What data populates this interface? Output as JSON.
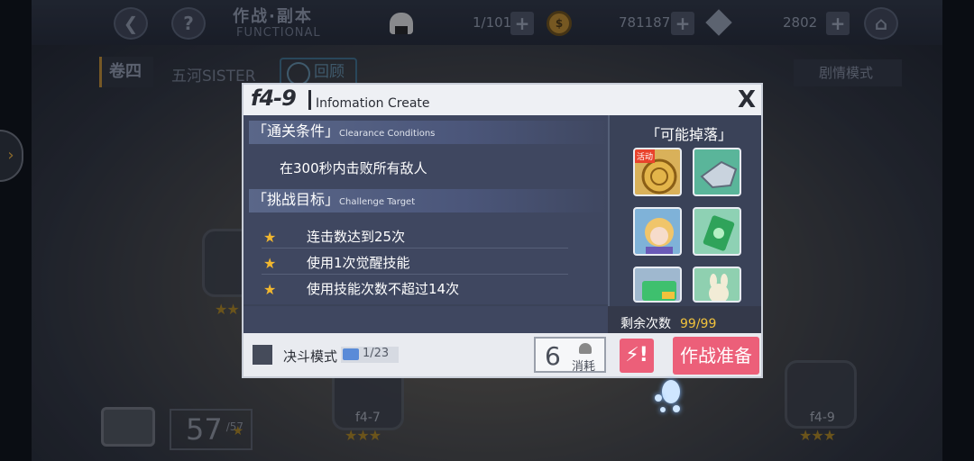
{
  "topbar": {
    "back_icon": "back-arrow-icon",
    "help": "?",
    "title": "作战·副本",
    "subtitle": "FUNCTIONAL",
    "stamina": "1/101",
    "coins": "781187",
    "gems": "2802",
    "plus": "+",
    "coin_glyph": "$"
  },
  "tabs": {
    "volume": "卷四",
    "chapter": "五河SISTER",
    "review": "回顾",
    "story_mode": "剧情模式"
  },
  "dialog": {
    "code": "f4-9",
    "title": "Infomation Create",
    "close": "X",
    "clear_label": "「通关条件」",
    "clear_sub": "Clearance Conditions",
    "condition": "在300秒内击败所有敌人",
    "challenge_label": "「挑战目标」",
    "challenge_sub": "Challenge Target",
    "goals": [
      "连击数达到25次",
      "使用1次觉醒技能",
      "使用技能次数不超过14次"
    ],
    "drops_title": "「可能掉落」",
    "drop_icons": [
      "coin-medal-icon",
      "mecha-part-icon",
      "character-portrait-icon",
      "green-card-icon",
      "gold-card-icon",
      "rabbit-figure-icon"
    ],
    "event_badge": "活动",
    "remaining_label": "剩余次数",
    "remaining_value": "99/99",
    "duel_mode": "决斗模式",
    "duel_tickets": "1/23",
    "cost": "6",
    "cost_label": "消耗",
    "prepare": "作战准备",
    "quick_icon": "quick-battle-icon",
    "quick_glyph": "⚡!"
  },
  "background": {
    "node_left": "f4-7",
    "node_right": "f4-9",
    "total_stars": "57",
    "total_max": "/57",
    "star_glyph": "★",
    "side_arrow": "›"
  },
  "colors": {
    "accent": "#ec5f79",
    "star": "#f1b72f",
    "remaining": "#f1c23c"
  }
}
